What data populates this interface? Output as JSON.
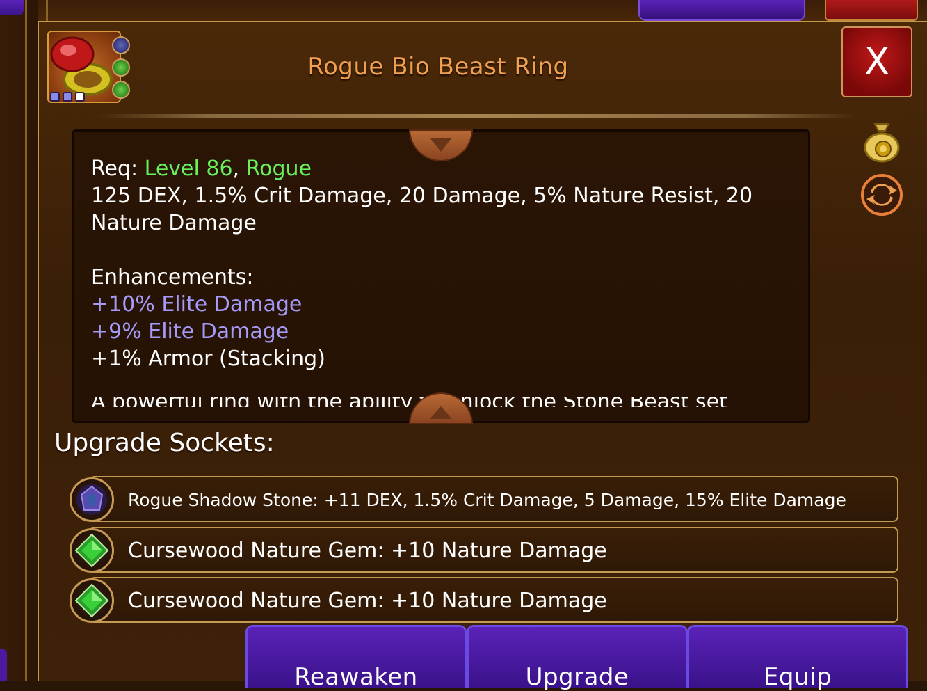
{
  "item": {
    "title": "Rogue Bio Beast Ring",
    "icon": "ring-icon"
  },
  "close": {
    "label": "X"
  },
  "side_buttons": [
    {
      "icon": "gold-bag-icon"
    },
    {
      "icon": "swap-icon"
    }
  ],
  "description": {
    "req_prefix": "Req: ",
    "req_level": "Level 86",
    "req_sep": ", ",
    "req_class": "Rogue",
    "stats_line1": "125 DEX, 1.5% Crit Damage, 20 Damage, 5% Nature Resist, 20",
    "stats_line2": "Nature Damage",
    "enh_heading": "Enhancements:",
    "enh_1": "+10% Elite Damage",
    "enh_2": "+9% Elite Damage",
    "enh_3": "+1% Armor (Stacking)",
    "flavor_partial": "A powerful ring with the ability to unlock the Stone Beast set"
  },
  "sockets": {
    "title": "Upgrade Sockets:",
    "items": [
      {
        "gem": "shadow-stone-icon",
        "text": "Rogue Shadow Stone: +11 DEX, 1.5% Crit Damage, 5 Damage, 15% Elite Damage"
      },
      {
        "gem": "nature-gem-icon",
        "text": "Cursewood Nature Gem: +10 Nature Damage"
      },
      {
        "gem": "nature-gem-icon",
        "text": "Cursewood Nature Gem: +10 Nature Damage"
      }
    ]
  },
  "actions": {
    "reawaken": "Reawaken",
    "upgrade": "Upgrade",
    "equip": "Equip"
  },
  "colors": {
    "title": "#f0a050",
    "requirement": "#6af05a",
    "enhancement": "#a59af8",
    "button_purple": "#5a22b8",
    "close_red": "#c01818"
  }
}
